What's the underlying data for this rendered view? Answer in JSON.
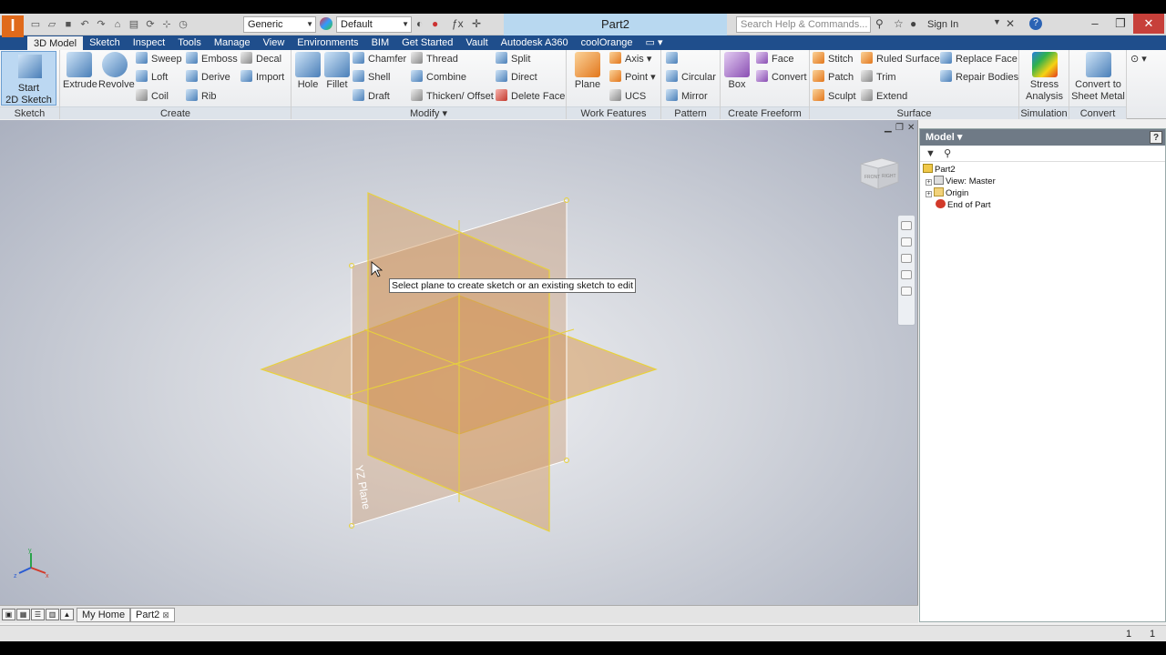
{
  "titlebar": {
    "appearance_combo": "Generic",
    "material_combo": "Default",
    "document_title": "Part2",
    "search_placeholder": "Search Help & Commands...",
    "sign_in": "Sign In"
  },
  "tabs": [
    "3D Model",
    "Sketch",
    "Inspect",
    "Tools",
    "Manage",
    "View",
    "Environments",
    "BIM",
    "Get Started",
    "Vault",
    "Autodesk A360",
    "coolOrange"
  ],
  "ribbon": {
    "sketch": {
      "label": "Sketch",
      "start_line1": "Start",
      "start_line2": "2D Sketch"
    },
    "create": {
      "label": "Create",
      "extrude": "Extrude",
      "revolve": "Revolve",
      "sweep": "Sweep",
      "loft": "Loft",
      "coil": "Coil",
      "emboss": "Emboss",
      "derive": "Derive",
      "rib": "Rib",
      "decal": "Decal",
      "import": "Import"
    },
    "modify": {
      "label": "Modify ▾",
      "hole": "Hole",
      "fillet": "Fillet",
      "chamfer": "Chamfer",
      "shell": "Shell",
      "draft": "Draft",
      "thread": "Thread",
      "combine": "Combine",
      "thicken": "Thicken/ Offset",
      "split": "Split",
      "direct": "Direct",
      "delete_face": "Delete Face"
    },
    "work_features": {
      "label": "Work Features",
      "plane": "Plane",
      "axis": "Axis",
      "point": "Point",
      "ucs": "UCS"
    },
    "pattern": {
      "label": "Pattern",
      "circular": "Circular",
      "mirror": "Mirror"
    },
    "freeform": {
      "label": "Create Freeform",
      "box": "Box",
      "face": "Face",
      "convert": "Convert"
    },
    "surface": {
      "label": "Surface",
      "stitch": "Stitch",
      "patch": "Patch",
      "sculpt": "Sculpt",
      "ruled_surface": "Ruled Surface",
      "trim": "Trim",
      "extend": "Extend",
      "replace_face": "Replace Face",
      "repair_bodies": "Repair Bodies"
    },
    "simulation": {
      "label": "Simulation",
      "stress_line1": "Stress",
      "stress_line2": "Analysis"
    },
    "convert": {
      "label": "Convert",
      "sheet_line1": "Convert to",
      "sheet_line2": "Sheet Metal"
    }
  },
  "viewport": {
    "tooltip": "Select plane to create sketch or an existing sketch to edit",
    "plane_label": "YZ Plane",
    "viewcube_left": "FRONT",
    "viewcube_right": "RIGHT",
    "triad_x": "x",
    "triad_y": "y",
    "triad_z": "z"
  },
  "browser": {
    "title": "Model ▾",
    "help": "?",
    "tree": {
      "root": "Part2",
      "view": "View: Master",
      "origin": "Origin",
      "end": "End of Part"
    }
  },
  "docbar": {
    "my_home": "My Home",
    "part_tab": "Part2"
  },
  "status": {
    "left_num": "1",
    "right_num": "1"
  },
  "colors": {
    "ribbon_tab_bg": "#1f4e8c",
    "plane_edge": "#e8d23a",
    "plane_fill": "#d79a5a"
  }
}
